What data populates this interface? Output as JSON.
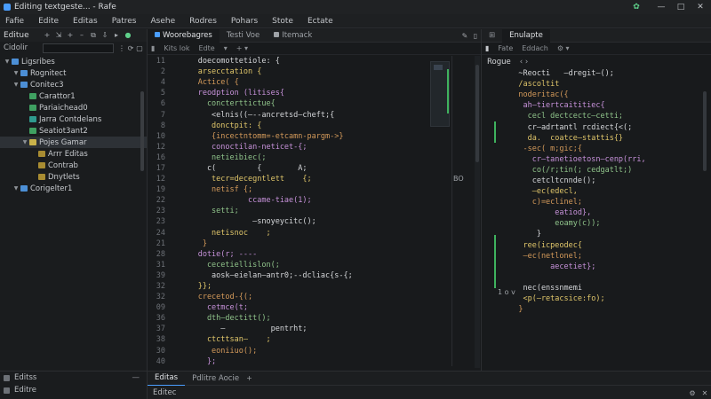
{
  "window": {
    "title": "Editing textgeste... - Rafe"
  },
  "menu": [
    "Fafie",
    "Edite",
    "Editas",
    "Patres",
    "Asehe",
    "Rodres",
    "Pohars",
    "Stote",
    "Ectate"
  ],
  "sidebar": {
    "title": "Editue",
    "filter_label": "Cidolir",
    "tree": [
      {
        "label": "Ligsribes",
        "icon": "folder-icon",
        "depth": 0,
        "selected": false
      },
      {
        "label": "Rognitect",
        "icon": "folder-icon",
        "depth": 1,
        "selected": false
      },
      {
        "label": "Conitec3",
        "icon": "folder-icon",
        "depth": 1,
        "selected": false
      },
      {
        "label": "Carattor1",
        "icon": "green-file-icon",
        "depth": 2,
        "selected": false
      },
      {
        "label": "Pariaichead0",
        "icon": "green-file-icon",
        "depth": 2,
        "selected": false
      },
      {
        "label": "Jarra Contdelans",
        "icon": "teal-file-icon",
        "depth": 2,
        "selected": false
      },
      {
        "label": "Seatiot3ant2",
        "icon": "green-file-icon",
        "depth": 2,
        "selected": false
      },
      {
        "label": "Pojes Gamar",
        "icon": "yellow-file-icon",
        "depth": 2,
        "selected": true
      },
      {
        "label": "Arrr Editas",
        "icon": "gold-file-icon",
        "depth": 3,
        "selected": false
      },
      {
        "label": "Contrab",
        "icon": "gold-file-icon",
        "depth": 3,
        "selected": false
      },
      {
        "label": "Dnytlets",
        "icon": "gold-file-icon",
        "depth": 3,
        "selected": false
      },
      {
        "label": "Corigelter1",
        "icon": "folder-icon",
        "depth": 1,
        "selected": false
      }
    ]
  },
  "editor1": {
    "tabs": [
      {
        "label": "Woorebagres",
        "active": true
      },
      {
        "label": "Testi Voe",
        "active": false
      },
      {
        "label": "Itemack",
        "active": false
      }
    ],
    "breadcrumbs": [
      "Kits lok",
      "Edte"
    ],
    "side_label": "BO",
    "lines": [
      {
        "n": "11",
        "text": "      doecomottetiole: {"
      },
      {
        "n": "2",
        "text": "      arsecctation {"
      },
      {
        "n": "4",
        "text": "      Actice( {"
      },
      {
        "n": "5",
        "text": "      reodption (litises{"
      },
      {
        "n": "6",
        "text": "        concterttictue{"
      },
      {
        "n": "7",
        "text": "         <elnis((—--ancretsd—cheft;{"
      },
      {
        "n": "8",
        "text": "         donctpit: {"
      },
      {
        "n": "10",
        "text": "         {incectntomm=-etcamn-pargm->}"
      },
      {
        "n": "12",
        "text": "         conoctilan-neticet-{;"
      },
      {
        "n": "16",
        "text": "         netieibiec(;"
      },
      {
        "n": "17",
        "text": "        c(         {        A;"
      },
      {
        "n": "12",
        "text": "         tecr=decegntlett    {;"
      },
      {
        "n": "19",
        "text": "         netisf {;"
      },
      {
        "n": "22",
        "text": "                 ccame-tiae(1);"
      },
      {
        "n": "23",
        "text": "         setti;"
      },
      {
        "n": "23",
        "text": "                  —snoyeycitc();"
      },
      {
        "n": "24",
        "text": "         netisnoc    ;"
      },
      {
        "n": "21",
        "text": "       }"
      },
      {
        "n": "28",
        "text": "      dotie(r; ----"
      },
      {
        "n": "31",
        "text": "        cecetiellislon(;"
      },
      {
        "n": "39",
        "text": "         aosk—eielan—antr0;--dcliac{s-{;"
      },
      {
        "n": "32",
        "text": "      }};"
      },
      {
        "n": "32",
        "text": "      crecetod-{(;"
      },
      {
        "n": "09",
        "text": "        cetmce(t;"
      },
      {
        "n": "36",
        "text": "        dth—dectitt();"
      },
      {
        "n": "37",
        "text": "           —          pentrht;"
      },
      {
        "n": "38",
        "text": "        ctcttsan—    ;"
      },
      {
        "n": "30",
        "text": "         eoniiuo();"
      },
      {
        "n": "40",
        "text": "        };"
      }
    ]
  },
  "editor2": {
    "tabs": [
      {
        "label": "Enulapte",
        "active": true
      }
    ],
    "breadcrumbs": [
      "Fate",
      "Eddach"
    ],
    "header_text": "Rogue",
    "header_extra": "‹ ›",
    "footer_text": "1 o v",
    "lines": [
      {
        "n": "",
        "text": "   ~Reocti   —dregit—();"
      },
      {
        "n": "",
        "text": "   /ascoltit"
      },
      {
        "n": "",
        "text": "   noderitac({"
      },
      {
        "n": "",
        "text": "    ah—tiertcaititiec{"
      },
      {
        "n": "",
        "text": "     cecl dectcectc—cetti;"
      },
      {
        "n": "",
        "text": "     cr—adrtantl rcdiect{<(;"
      },
      {
        "n": "",
        "text": "     da.  coatce—stattis{}"
      },
      {
        "n": "",
        "text": "    -sec( m;gic;{"
      },
      {
        "n": "",
        "text": "      cr—tanetioetosn—cenp(rri,"
      },
      {
        "n": "",
        "text": "      co(/r;tin(; cedgatlt;)"
      },
      {
        "n": "",
        "text": "      cetcltcnnde();"
      },
      {
        "n": "",
        "text": "      —ec(edecl,"
      },
      {
        "n": "",
        "text": "      c)=eclinel;"
      },
      {
        "n": "",
        "text": "           eatiod},"
      },
      {
        "n": "",
        "text": "           eoamy(c));"
      },
      {
        "n": "",
        "text": "       }"
      },
      {
        "n": "",
        "text": "    ree(icpeodec{"
      },
      {
        "n": "",
        "text": "    —ec(netlonel;"
      },
      {
        "n": "",
        "text": "          aecetiet};"
      },
      {
        "n": "",
        "text": ""
      },
      {
        "n": "",
        "text": "    nec(enssnmemi"
      },
      {
        "n": "",
        "text": "    <p(—retacsice:fo);"
      },
      {
        "n": "",
        "text": "   }"
      }
    ]
  },
  "bottom_left": {
    "rows": [
      "Editss",
      "Editre"
    ]
  },
  "bottom_panel": {
    "tabs": [
      {
        "label": "Editas",
        "active": true
      },
      {
        "label": "Pdlitre Aocie",
        "active": false
      }
    ],
    "body_text": "Editec"
  }
}
